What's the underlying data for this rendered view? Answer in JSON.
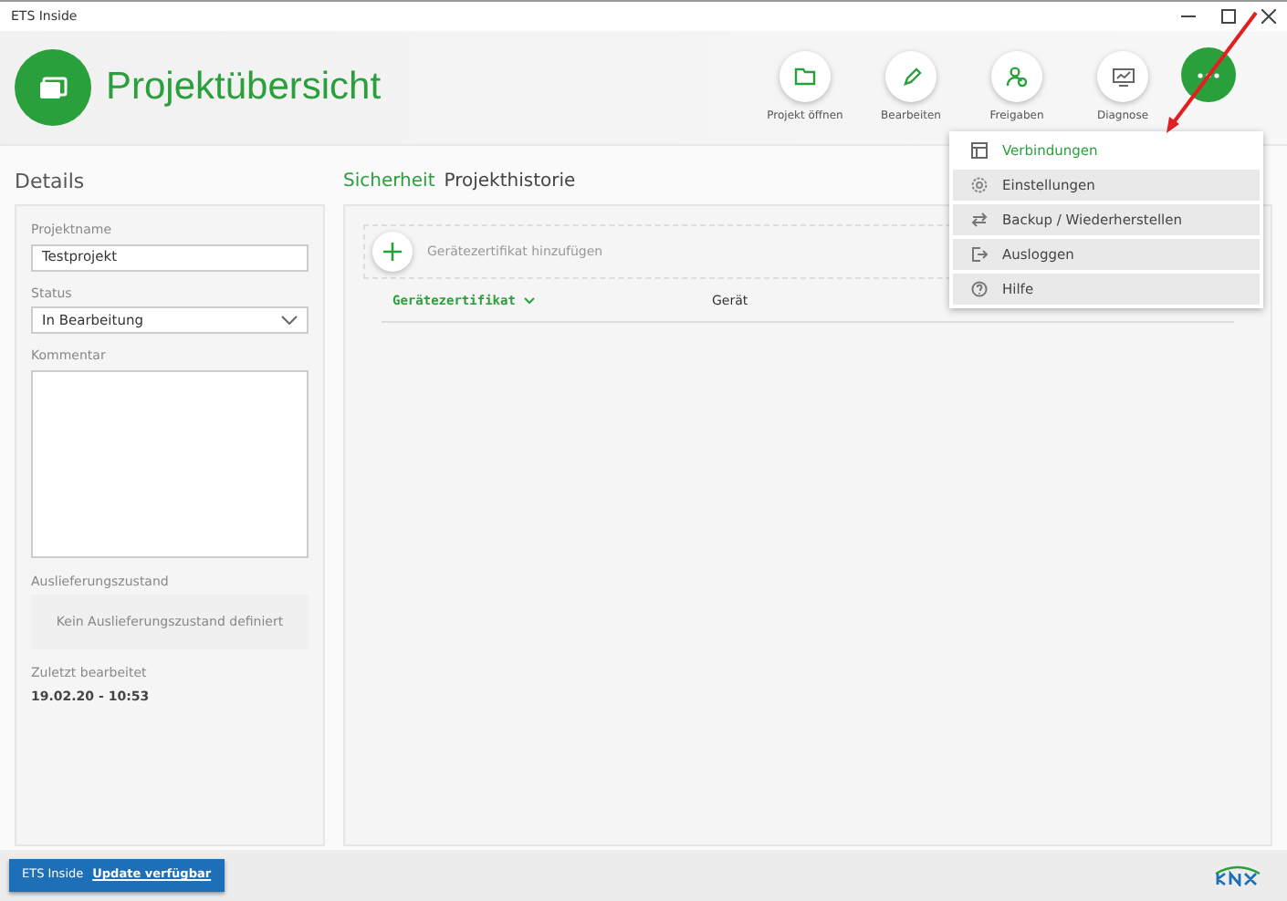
{
  "window": {
    "title": "ETS Inside"
  },
  "header": {
    "title": "Projektübersicht"
  },
  "toolbar": [
    {
      "kind": "folder",
      "label": "Projekt öffnen"
    },
    {
      "kind": "pencil",
      "label": "Bearbeiten"
    },
    {
      "kind": "share",
      "label": "Freigaben"
    },
    {
      "kind": "monitor",
      "label": "Diagnose"
    }
  ],
  "menu": {
    "items": [
      {
        "kind": "connections",
        "label": "Verbindungen",
        "selected": true
      },
      {
        "kind": "settings",
        "label": "Einstellungen",
        "selected": false
      },
      {
        "kind": "backup",
        "label": "Backup / Wiederherstellen",
        "selected": false
      },
      {
        "kind": "logout",
        "label": "Ausloggen",
        "selected": false
      },
      {
        "kind": "help",
        "label": "Hilfe",
        "selected": false
      }
    ]
  },
  "details": {
    "title": "Details",
    "name_label": "Projektname",
    "name_value": "Testprojekt",
    "status_label": "Status",
    "status_value": "In Bearbeitung",
    "comment_label": "Kommentar",
    "delivery_label": "Auslieferungszustand",
    "delivery_value": "Kein Auslieferungszustand definiert",
    "edited_label": "Zuletzt bearbeitet",
    "edited_value": "19.02.20 - 10:53"
  },
  "tabs": [
    {
      "label": "Sicherheit",
      "selected": true
    },
    {
      "label": "Projekthistorie",
      "selected": false
    }
  ],
  "security": {
    "add_label": "Gerätezertifikat hinzufügen",
    "columns": [
      {
        "label": "Gerätezertifikat",
        "sorted": true
      },
      {
        "label": "Gerät",
        "sorted": false
      }
    ]
  },
  "status_bar": {
    "app": "ETS Inside",
    "link": "Update verfügbar"
  }
}
